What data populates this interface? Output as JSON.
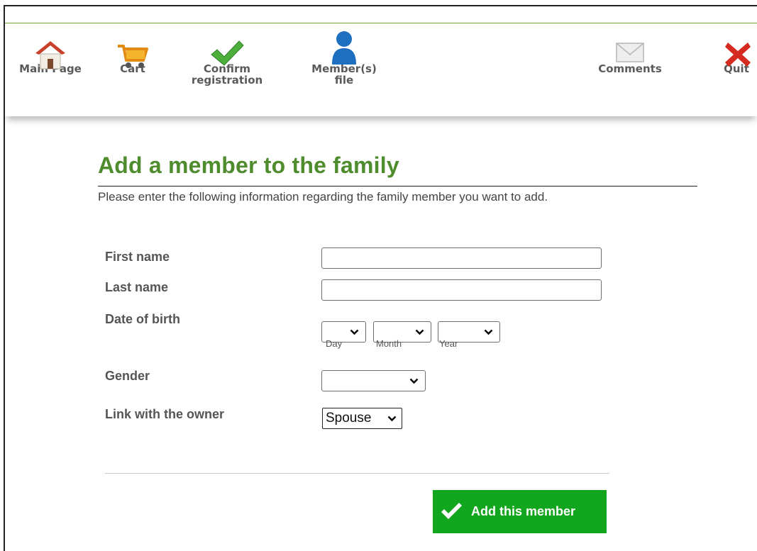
{
  "nav": {
    "items": [
      {
        "id": "main-page",
        "label": "Main Page",
        "icon": "home-icon"
      },
      {
        "id": "cart",
        "label": "Cart",
        "icon": "cart-icon"
      },
      {
        "id": "confirm-registration",
        "label_line1": "Confirm",
        "label_line2": "registration",
        "icon": "checkmark-icon"
      },
      {
        "id": "members-file",
        "label_line1": "Member(s)",
        "label_line2": "file",
        "icon": "person-icon"
      },
      {
        "id": "comments",
        "label": "Comments",
        "icon": "envelope-icon"
      },
      {
        "id": "quit",
        "label": "Quit",
        "icon": "close-icon"
      }
    ]
  },
  "page": {
    "title": "Add a member to the family",
    "intro": "Please enter the following information regarding the family member you want to add."
  },
  "form": {
    "first_name_label": "First name",
    "first_name_value": "",
    "last_name_label": "Last name",
    "last_name_value": "",
    "dob_label": "Date of birth",
    "dob_day_caption": "Day",
    "dob_month_caption": "Month",
    "dob_year_caption": "Year",
    "gender_label": "Gender",
    "link_label": "Link with the owner",
    "link_value": "Spouse"
  },
  "actions": {
    "add_label": "Add this member"
  },
  "colors": {
    "title_green": "#4f8c2e",
    "button_green": "#12a51e",
    "nav_line_green": "#7aa23a",
    "quit_red": "#d42a20",
    "person_blue": "#1f6fc0"
  }
}
